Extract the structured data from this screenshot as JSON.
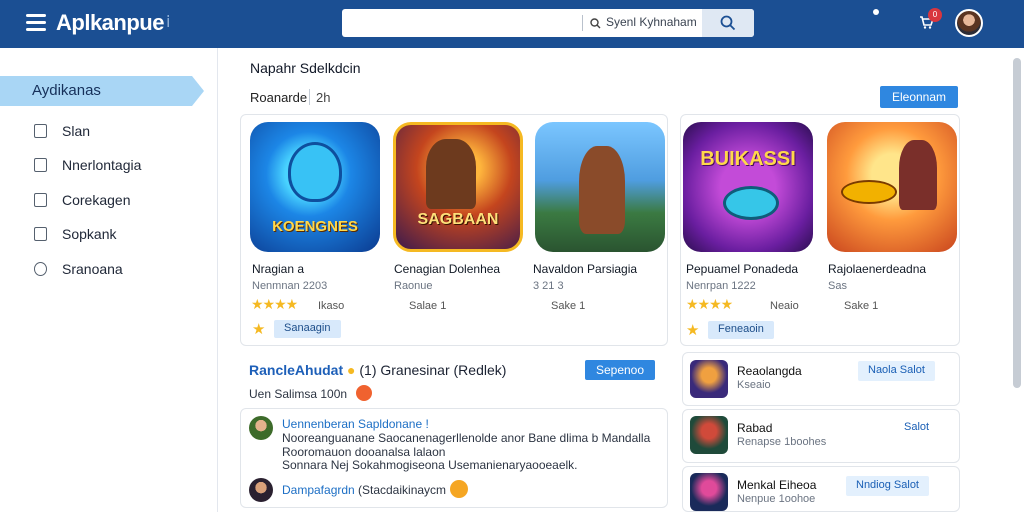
{
  "header": {
    "logo": "Aplkanpue",
    "search_placeholder": "Syenl Kyhnaham",
    "cart_count": "0"
  },
  "sidebar": {
    "active": "Aydikanas",
    "items": [
      {
        "label": "Slan",
        "icon": "check-square-icon"
      },
      {
        "label": "Nnerlontagia",
        "icon": "document-icon"
      },
      {
        "label": "Corekagen",
        "icon": "box-icon"
      },
      {
        "label": "Sopkank",
        "icon": "note-icon"
      },
      {
        "label": "Sranoana",
        "icon": "clock-icon"
      }
    ]
  },
  "main": {
    "title": "Napahr Sdelkdcin",
    "subtitle": "Roanarde",
    "subtitle_count": "2h",
    "top_button": "Eleonnam",
    "apps": [
      {
        "name": "Nragian a",
        "meta": "Nenmnan 2203",
        "tile": "KOENGNES",
        "stars": "★★★★",
        "rating": "Ikaso",
        "action": "Sanaagin"
      },
      {
        "name": "Cenagian Dolenhea",
        "meta": "Raonue",
        "tile": "SAGBAAN",
        "stars": "",
        "rating": "Salae 1",
        "action": ""
      },
      {
        "name": "Navaldon Parsiagia",
        "meta": "3 21 3",
        "tile": "",
        "stars": "",
        "rating": "Sake 1",
        "action": ""
      },
      {
        "name": "Pepuamel Ponadeda",
        "meta": "Nenrpan 1222",
        "tile": "BUIKASSI",
        "stars": "★★★★",
        "rating": "Neaio",
        "action": "Feneaoin"
      },
      {
        "name": "Rajolaenerdeadna",
        "meta": "Sas",
        "tile": "",
        "stars": "",
        "rating": "Sake 1",
        "action": ""
      }
    ],
    "featured": {
      "title": "RancleAhudat",
      "title_rest": "(1) Granesinar (Redlek)",
      "button": "Sepenoo",
      "subtitle": "Uen Salimsa 100n",
      "comments": [
        {
          "author": "Uennenberan Sapldonane !",
          "text": "Nooreanguanane Saocanenagerllenolde anor Bane dlima b Mandalla",
          "text2": "Rooromauon dooanalsa lalaon",
          "text3": "Sonnara Nej Sokahmogiseona Usemanienaryaooeaelk."
        },
        {
          "author": "Dampafagrdn",
          "text": "(Stacdaikinaycm",
          "text2": "",
          "text3": ""
        }
      ]
    },
    "side_list": [
      {
        "title": "Reaolangda",
        "meta": "Kseaio",
        "button": "Naola Salot"
      },
      {
        "title": "Rabad",
        "meta": "Renapse 1boohes",
        "button": "Salot"
      },
      {
        "title": "Menkal Eiheoa",
        "meta": "Nenpue 1oohoe",
        "button": "Nndiog Salot"
      }
    ]
  },
  "colors": {
    "topbar": "#1b4f93",
    "accent": "#2f87e0",
    "sidebar_active": "#a9d6f5",
    "star": "#f5b922"
  }
}
